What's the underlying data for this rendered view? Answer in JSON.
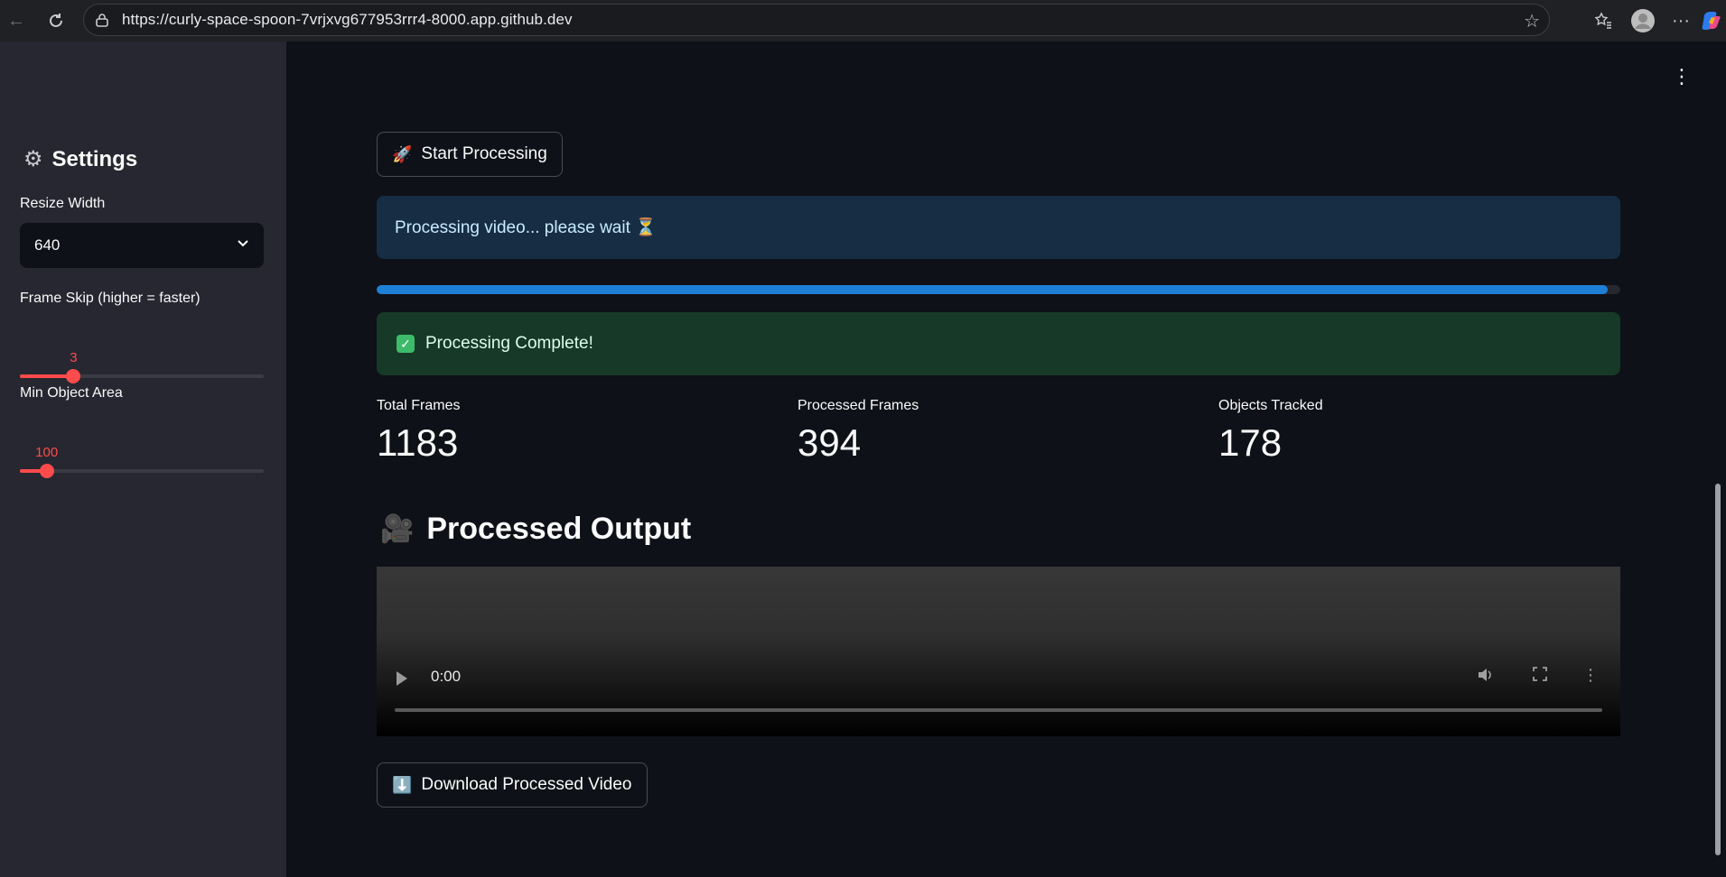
{
  "browser": {
    "url": "https://curly-space-spoon-7vrjxvg677953rrr4-8000.app.github.dev"
  },
  "sidebar": {
    "title": "Settings",
    "resize_width": {
      "label": "Resize Width",
      "value": "640"
    },
    "frame_skip": {
      "label": "Frame Skip (higher = faster)",
      "value": "3",
      "fraction": 0.22
    },
    "min_area": {
      "label": "Min Object Area",
      "value": "100",
      "fraction": 0.11
    }
  },
  "main": {
    "start_button": {
      "emoji": "🚀",
      "label": "Start Processing"
    },
    "info_message": "Processing video... please wait ⏳",
    "progress": 0.99,
    "success_message": "Processing Complete!",
    "metrics": [
      {
        "label": "Total Frames",
        "value": "1183"
      },
      {
        "label": "Processed Frames",
        "value": "394"
      },
      {
        "label": "Objects Tracked",
        "value": "178"
      }
    ],
    "output_title": {
      "emoji": "🎥",
      "text": "Processed Output"
    },
    "video": {
      "time": "0:00"
    },
    "download_button": {
      "emoji": "⬇️",
      "label": "Download Processed Video"
    }
  },
  "colors": {
    "accent": "#ff4b4b",
    "info_bg": "#172d43",
    "success_bg": "#173928",
    "progress": "#1e7fd6"
  }
}
